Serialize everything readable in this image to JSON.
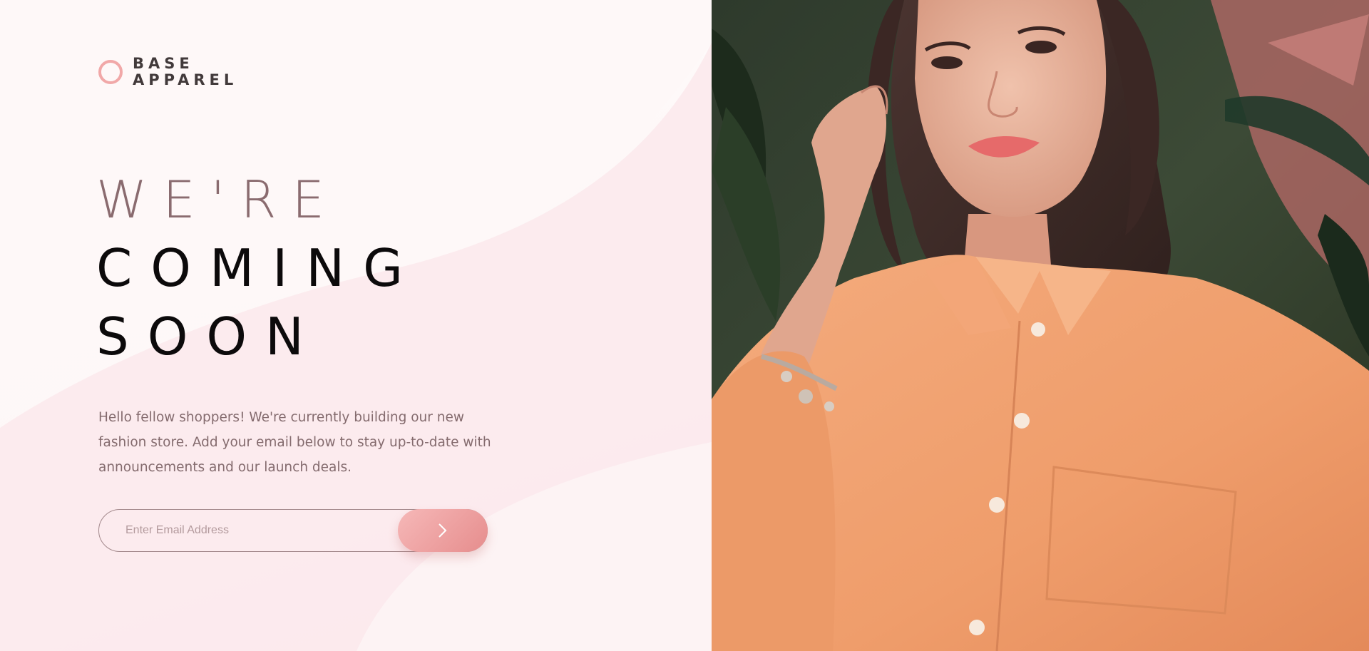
{
  "brand": {
    "line1": "BASE",
    "line2": "APPAREL",
    "accent": "#f1a8a8"
  },
  "hero": {
    "line1": "WE'RE",
    "line2": "COMING",
    "line3": "SOON"
  },
  "description": "Hello fellow shoppers! We're currently building our new fashion store. Add your email below to stay up-to-date with announcements and our launch deals.",
  "form": {
    "placeholder": "Enter Email Address",
    "submit_icon": "chevron-right-icon"
  },
  "photo": {
    "subject": "hero-photo"
  },
  "colors": {
    "text_soft": "#8a6b6f",
    "text_dark": "#0c0a0b",
    "button_start": "#f6b8b8",
    "button_end": "#e68d8d",
    "shirt": "#f2a072"
  }
}
